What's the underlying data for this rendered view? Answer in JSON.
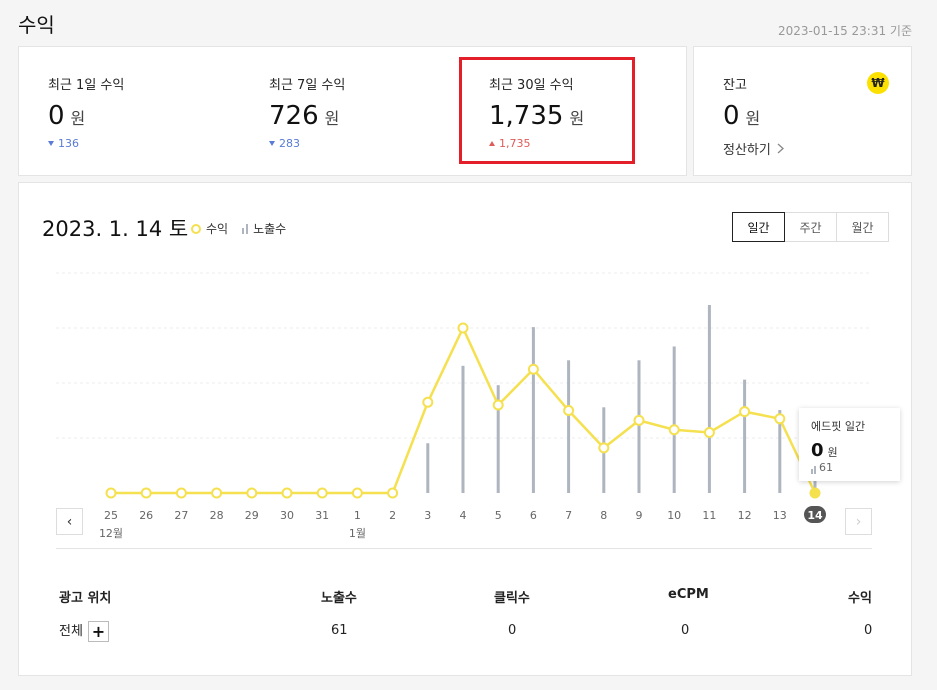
{
  "header": {
    "title": "수익",
    "timestamp": "2023-01-15 23:31 기준"
  },
  "stats": [
    {
      "label": "최근 1일 수익",
      "value": "0",
      "unit": "원",
      "change": "136",
      "direction": "down"
    },
    {
      "label": "최근 7일 수익",
      "value": "726",
      "unit": "원",
      "change": "283",
      "direction": "down"
    },
    {
      "label": "최근 30일 수익",
      "value": "1,735",
      "unit": "원",
      "change": "1,735",
      "direction": "up"
    }
  ],
  "balance": {
    "label": "잔고",
    "value": "0",
    "unit": "원",
    "settle_label": "정산하기",
    "icon": "won-icon",
    "icon_glyph": "₩"
  },
  "chart_panel": {
    "date_title": "2023. 1. 14 토",
    "legend": {
      "revenue": "수익",
      "impressions": "노출수"
    },
    "tabs": [
      {
        "label": "일간",
        "active": true
      },
      {
        "label": "주간",
        "active": false
      },
      {
        "label": "월간",
        "active": false
      }
    ],
    "tooltip": {
      "title": "에드핏 일간",
      "value": "0",
      "unit": "원",
      "impressions": "61"
    }
  },
  "chart_data": {
    "type": "line",
    "categories": [
      "25",
      "26",
      "27",
      "28",
      "29",
      "30",
      "31",
      "1",
      "2",
      "3",
      "4",
      "5",
      "6",
      "7",
      "8",
      "9",
      "10",
      "11",
      "12",
      "13",
      "14"
    ],
    "month_labels": [
      {
        "index": 0,
        "label": "12월"
      },
      {
        "index": 7,
        "label": "1월"
      }
    ],
    "selected_index": 20,
    "series": [
      {
        "name": "수익",
        "kind": "line",
        "color": "#f5e050",
        "values": [
          0,
          0,
          0,
          0,
          0,
          0,
          0,
          0,
          0,
          165,
          300,
          160,
          225,
          150,
          82,
          132,
          115,
          110,
          148,
          135,
          0
        ]
      },
      {
        "name": "노출수",
        "kind": "bar",
        "color": "#aeb5bf",
        "values": [
          0,
          0,
          0,
          0,
          0,
          0,
          0,
          0,
          0,
          90,
          230,
          195,
          300,
          240,
          155,
          240,
          265,
          340,
          205,
          150,
          61
        ]
      }
    ]
  },
  "table": {
    "headers": [
      "광고 위치",
      "노출수",
      "클릭수",
      "eCPM",
      "수익"
    ],
    "rows": [
      {
        "position": "전체",
        "impressions": "61",
        "clicks": "0",
        "ecpm": "0",
        "revenue": "0"
      }
    ]
  },
  "colors": {
    "highlight": "#e3202a",
    "revenue_line": "#f5e050",
    "impression_bar": "#aeb5bf",
    "down": "#5a7bd6",
    "up": "#e05a5a"
  }
}
